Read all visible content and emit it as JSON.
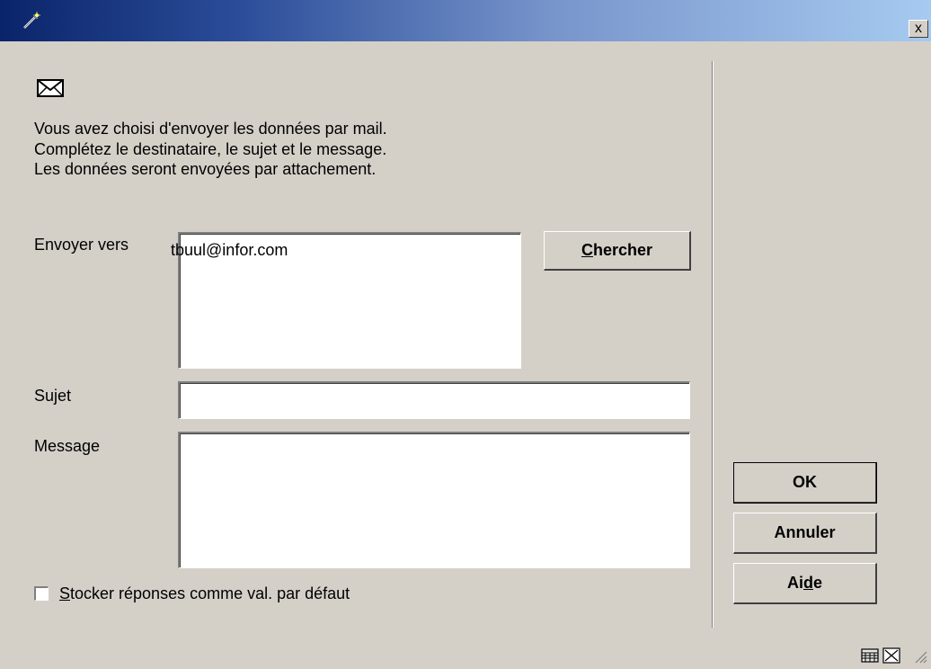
{
  "window": {
    "title": "",
    "close_label": "x"
  },
  "intro": {
    "line1": "Vous avez choisi d'envoyer les données par mail.",
    "line2": "Complétez le destinataire, le sujet et le message.",
    "line3": "Les données seront envoyées par attachement."
  },
  "form": {
    "to_label": "Envoyer vers",
    "to_value": "tbuul@infor.com",
    "search_button_prefix": "C",
    "search_button_rest": "hercher",
    "subject_label": "Sujet",
    "subject_value": "",
    "message_label": "Message",
    "message_value": ""
  },
  "checkbox": {
    "label_prefix": "S",
    "label_rest": "tocker réponses comme val. par défaut",
    "checked": false
  },
  "buttons": {
    "ok": "OK",
    "cancel": "Annuler",
    "help_pre": "Ai",
    "help_ul": "d",
    "help_post": "e"
  },
  "icons": {
    "title": "wand-icon",
    "mail": "envelope-icon",
    "status_1": "keyboard-icon",
    "status_2": "resize-icon"
  },
  "colors": {
    "titlebar_start": "#0a246a",
    "titlebar_end": "#a6caf0",
    "face": "#d4d0c8"
  }
}
